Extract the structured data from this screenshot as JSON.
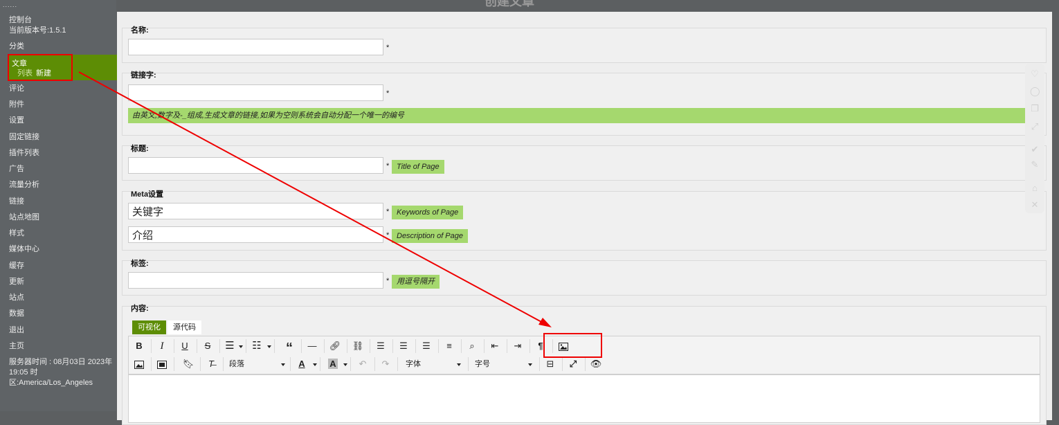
{
  "sidebar": {
    "dots": "......",
    "items": [
      {
        "label": "控制台"
      },
      {
        "label": "当前版本号:1.5.1"
      },
      {
        "label": "分类"
      },
      {
        "label": "评论"
      },
      {
        "label": "附件"
      },
      {
        "label": "设置"
      },
      {
        "label": "固定链接"
      },
      {
        "label": "插件列表"
      },
      {
        "label": "广告"
      },
      {
        "label": "流量分析"
      },
      {
        "label": "链接"
      },
      {
        "label": "站点地图"
      },
      {
        "label": "样式"
      },
      {
        "label": "媒体中心"
      },
      {
        "label": "缓存"
      },
      {
        "label": "更新"
      },
      {
        "label": "站点"
      },
      {
        "label": "数据"
      },
      {
        "label": "退出"
      },
      {
        "label": "主页"
      }
    ],
    "active": {
      "label": "文章",
      "sub_list": "列表",
      "sub_new": "新建"
    },
    "server_time": "服务器时间 : 08月03日 2023年 19:05 时区:America/Los_Angeles"
  },
  "dialog": {
    "title": "创建文章",
    "name": {
      "label": "名称:",
      "value": "",
      "required": "*"
    },
    "slug": {
      "label": "链接字:",
      "value": "",
      "required": "*",
      "hint": "由英文,数字及-_组成,生成文章的链接,如果为空则系统会自动分配一个唯一的编号"
    },
    "title_field": {
      "label": "标题:",
      "value": "",
      "required": "*",
      "hint": "Title of Page"
    },
    "meta": {
      "label": "Meta设置",
      "keywords_value": "关键字",
      "keywords_hint": "Keywords of Page",
      "description_value": "介绍",
      "description_hint": "Description of Page",
      "required": "*"
    },
    "tags": {
      "label": "标签:",
      "value": "",
      "required": "*",
      "hint": "用逗号隔开"
    },
    "content": {
      "label": "内容:",
      "tab_visual": "可视化",
      "tab_source": "源代码",
      "paragraph": "段落",
      "font": "字体",
      "font_size": "字号"
    }
  },
  "toolbar_icons": [
    "bold-icon",
    "italic-icon",
    "underline-icon",
    "strikethrough-icon",
    "bullet-list-icon",
    "numbered-list-icon",
    "blockquote-icon",
    "horizontal-rule-icon",
    "link-icon",
    "unlink-icon",
    "align-left-icon",
    "align-center-icon",
    "align-right-icon",
    "align-justify-icon",
    "find-icon",
    "outdent-icon",
    "indent-icon",
    "pilcrow-icon",
    "image-icon",
    "image-insert-icon",
    "media-icon",
    "bookmark-icon",
    "clear-format-icon",
    "text-color-icon",
    "background-color-icon",
    "undo-icon",
    "redo-icon",
    "page-break-icon",
    "fullscreen-icon",
    "preview-icon"
  ],
  "colors": {
    "accent": "#5d8d05",
    "hint_bg": "#a5d86e",
    "annotation": "#e00000"
  }
}
